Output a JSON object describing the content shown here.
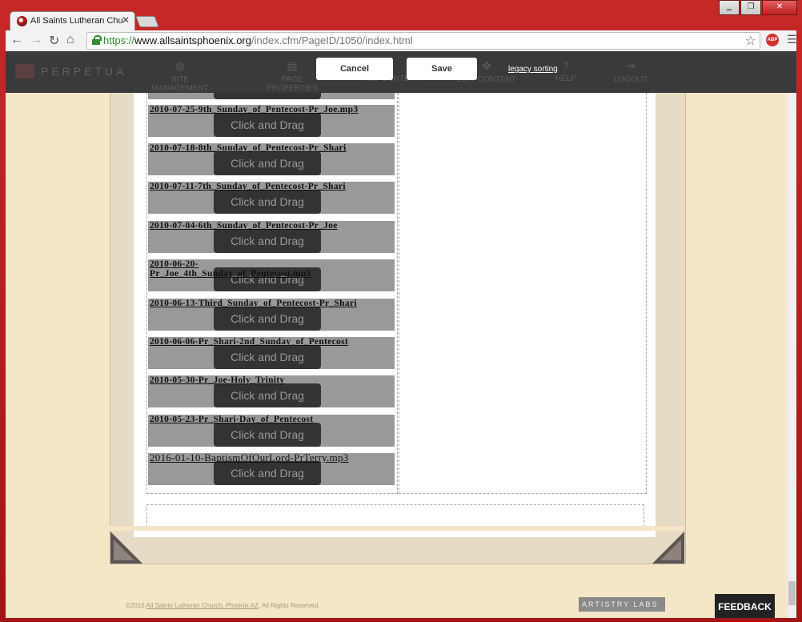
{
  "browser": {
    "tab_title": "All Saints Lutheran Church",
    "tab_close": "✕",
    "url_scheme": "https://",
    "url_host": "www.allsaintsphoenix.org",
    "url_path": "/index.cfm/PageID/1050/index.html",
    "abp_label": "ABP",
    "window_buttons": [
      "‗",
      "❐",
      "✕"
    ]
  },
  "cms": {
    "logo": "PERPETUA",
    "nav": [
      {
        "label": "SITE MANAGEMENT",
        "icon": "globe-icon"
      },
      {
        "label": "PAGE PROPERTIES",
        "icon": "page-icon"
      },
      {
        "label": "ADD CONTENT",
        "icon": "plus-icon"
      },
      {
        "label": "EDIT CONTENT",
        "icon": "move-icon"
      },
      {
        "label": "HELP",
        "icon": "help-icon"
      },
      {
        "label": "LOGOUT",
        "icon": "logout-icon"
      }
    ],
    "cancel_label": "Cancel",
    "save_label": "Save",
    "legacy_sorting": "legacy sorting"
  },
  "list": {
    "drag_label": "Click and Drag",
    "items": [
      "2010-07-25-9th_Sunday_of_Pentecost-Pr_Joe.mp3",
      "2010-07-18-8th_Sunday_of_Pentecost-Pr_Shari",
      "2010-07-11-7th_Sunday_of_Pentecost-Pr_Shari",
      "2010-07-04-6th_Sunday_of_Pentecost-Pr_Joe",
      "2010-06-20-\nPr_Joe_4th_Sunday_of_Pentecost.mp3",
      "2010-06-13-Third_Sunday_of_Pentecost-Pr_Shari",
      "2010-06-06-Pr_Shari-2nd_Sunday_of_Pentecost",
      "2010-05-30-Pr_Joe-Holy_Trinity",
      "2010-05-23-Pr_Shari-Day_of_Pentecost",
      "2016-01-10-BaptismOfOurLord-PrTerry.mp3"
    ]
  },
  "footer": {
    "copyright_prefix": "©2016 ",
    "church_link": "All Saints Lutheran Church, Phoenix AZ",
    "copyright_suffix": ". All Rights Reserved.",
    "artistry": "ARTISTRY LABS",
    "feedback": "FEEDBACK"
  }
}
